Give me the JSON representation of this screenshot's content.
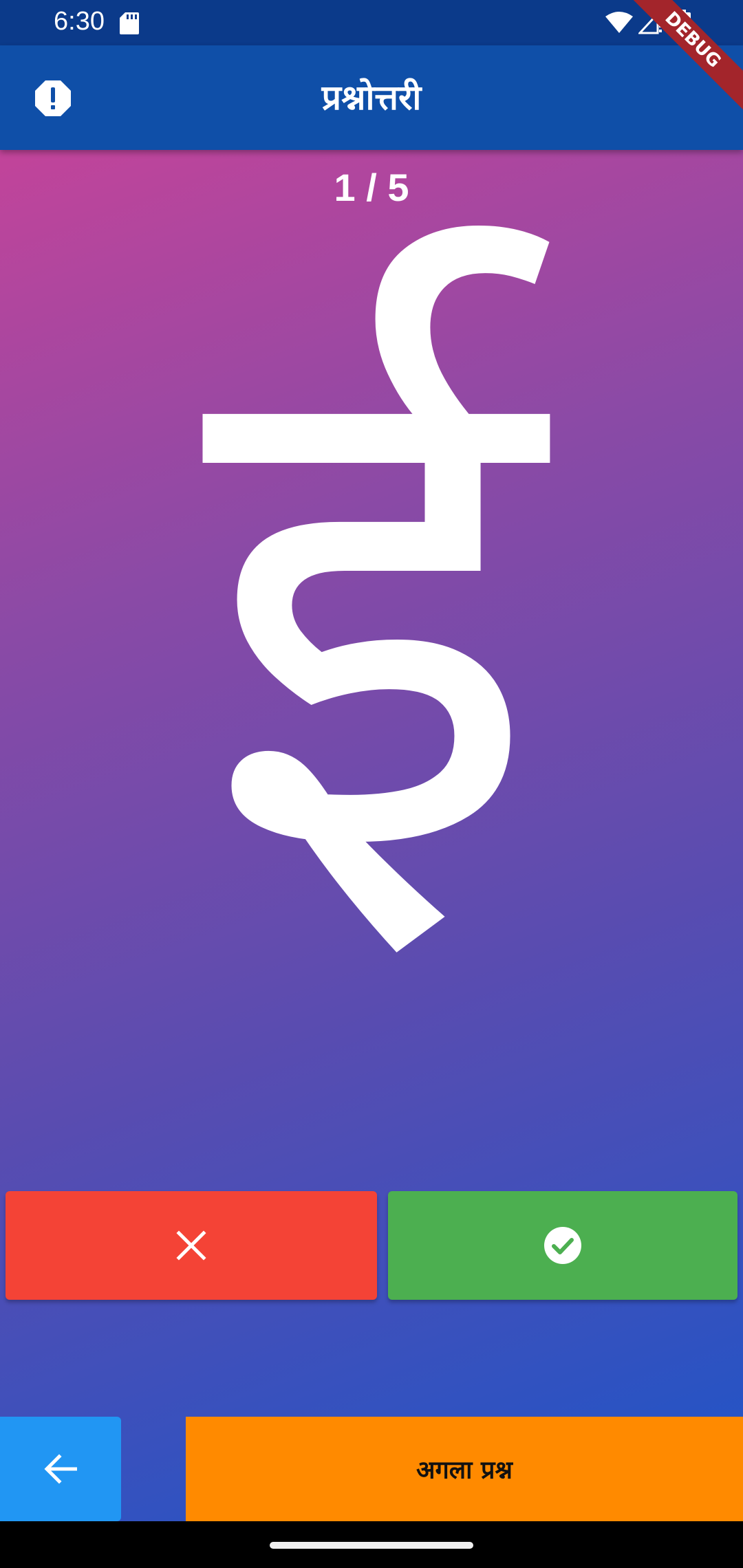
{
  "status_bar": {
    "time": "6:30"
  },
  "app_bar": {
    "title": "प्रश्नोत्तरी",
    "info_icon": "info-octagon-icon",
    "debug_banner": "DEBUG"
  },
  "quiz": {
    "progress": "1 / 5",
    "letter": "ई"
  },
  "buttons": {
    "wrong_icon": "close-icon",
    "correct_icon": "check-circle-icon",
    "back_icon": "arrow-back-icon",
    "next_label": "अगला प्रश्न"
  },
  "colors": {
    "status_bar": "#0b3a8a",
    "app_bar": "#0f4fa8",
    "gradient_start": "#c2449a",
    "gradient_end": "#1d55c8",
    "wrong": "#f44336",
    "correct": "#4caf50",
    "back": "#2196f3",
    "next": "#ff8a00"
  }
}
